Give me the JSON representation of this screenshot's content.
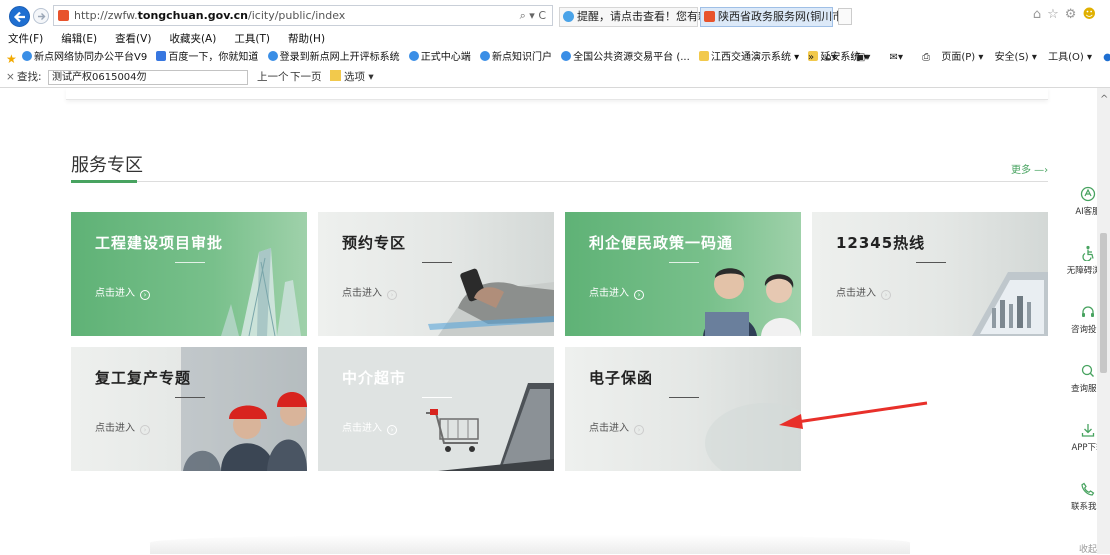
{
  "browser": {
    "address": {
      "prefix": "http://zwfw.",
      "host": "tongchuan.gov.cn",
      "path": "/icity/public/index",
      "tools": "⌕ ▾ C"
    },
    "tabs": [
      {
        "label": "提醒，请点击查看！您有新消息"
      },
      {
        "label": "陕西省政务服务网(铜川市)",
        "close": "×"
      }
    ],
    "menu": [
      "文件(F)",
      "编辑(E)",
      "查看(V)",
      "收藏夹(A)",
      "工具(T)",
      "帮助(H)"
    ],
    "favorites": [
      {
        "label": "新点网络协同办公平台V9",
        "icon": "ie"
      },
      {
        "label": "百度一下，你就知道",
        "icon": "paw"
      },
      {
        "label": "登录到新点网上开评标系统",
        "icon": "ie"
      },
      {
        "label": "正式中心端",
        "icon": "ie"
      },
      {
        "label": "新点知识门户",
        "icon": "ie"
      },
      {
        "label": "全国公共资源交易平台 (...",
        "icon": "ie"
      },
      {
        "label": "江西交通演示系统 ▾",
        "icon": "folder"
      },
      {
        "label": "延安系统 ▾",
        "icon": "folder"
      }
    ],
    "command_bar": [
      "» ",
      "▾",
      "▾",
      "▾",
      "页面(P) ▾",
      "安全(S) ▾",
      "工具(O) ▾",
      "▾"
    ],
    "find": {
      "close": "×",
      "label": "查找:",
      "value": "测试产权0615004勿",
      "prev": "上一个",
      "next": "下一页",
      "options": "选项 ▾"
    }
  },
  "section": {
    "title": "服务专区",
    "more": "更多 —›"
  },
  "cards": [
    {
      "title": "工程建设项目审批",
      "enter": "点击进入",
      "style": "green"
    },
    {
      "title": "预约专区",
      "enter": "点击进入",
      "style": "gray"
    },
    {
      "title": "利企便民政策一码通",
      "enter": "点击进入",
      "style": "green"
    },
    {
      "title": "12345热线",
      "enter": "点击进入",
      "style": "gray"
    },
    {
      "title": "复工复产专题",
      "enter": "点击进入",
      "style": "gray"
    },
    {
      "title": "中介超市",
      "enter": "点击进入",
      "style": "faded"
    },
    {
      "title": "电子保函",
      "enter": "点击进入",
      "style": "gray"
    }
  ],
  "side_panel": [
    {
      "label": "AI客服",
      "icon": "ai-chat-icon"
    },
    {
      "label": "无障碍浏览",
      "icon": "accessibility-icon"
    },
    {
      "label": "咨询投诉",
      "icon": "headset-icon"
    },
    {
      "label": "查询服务",
      "icon": "search-icon"
    },
    {
      "label": "APP下载",
      "icon": "download-icon"
    },
    {
      "label": "联系我们",
      "icon": "phone-icon"
    }
  ],
  "side_collapse": "收起",
  "colors": {
    "accent": "#48a360",
    "annotation": "#e8302a",
    "ie_blue": "#1f6fd1"
  }
}
